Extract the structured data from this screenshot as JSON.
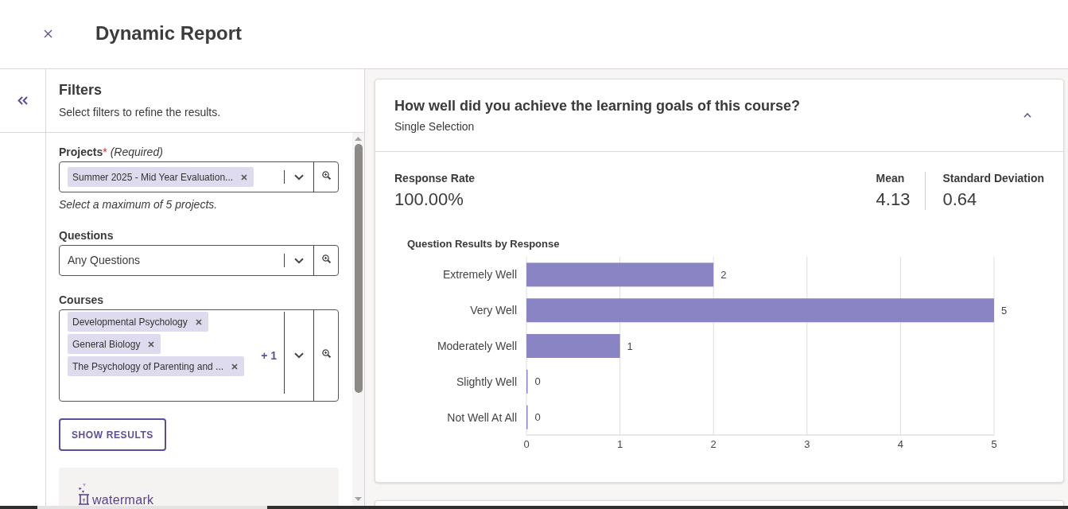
{
  "header": {
    "title": "Dynamic Report"
  },
  "filters": {
    "title": "Filters",
    "subtitle": "Select filters to refine the results.",
    "fields": [
      {
        "label": "Projects",
        "required_mark": "*",
        "required_note": "(Required)",
        "chips": [
          "Summer 2025 - Mid Year Evaluation..."
        ],
        "hint": "Select a maximum of 5 projects."
      },
      {
        "label": "Questions",
        "value": "Any Questions"
      },
      {
        "label": "Courses",
        "chips": [
          "Developmental Psychology",
          "General Biology",
          "The Psychology of Parenting and ..."
        ],
        "overflow_count": "+ 1"
      }
    ],
    "button": "SHOW RESULTS",
    "logo": "watermark"
  },
  "report_card": {
    "question": "How well did you achieve the learning goals of this course?",
    "type": "Single Selection",
    "expanded": true,
    "stats": [
      {
        "label": "Response Rate",
        "value": "100.00%"
      },
      {
        "label": "Mean",
        "value": "4.13"
      },
      {
        "label": "Standard Deviation",
        "value": "0.64"
      }
    ],
    "chart_data": {
      "type": "bar",
      "orientation": "horizontal",
      "title": "Question Results by Response",
      "categories": [
        "Extremely Well",
        "Very Well",
        "Moderately Well",
        "Slightly Well",
        "Not Well At All"
      ],
      "series": [
        {
          "color": "#8a84c4",
          "values": [
            2,
            5,
            1,
            0,
            0
          ]
        }
      ],
      "xlim": [
        0,
        5
      ],
      "xticks": [
        0,
        1,
        2,
        3,
        4,
        5
      ],
      "grid": true,
      "data_labels": true
    }
  }
}
